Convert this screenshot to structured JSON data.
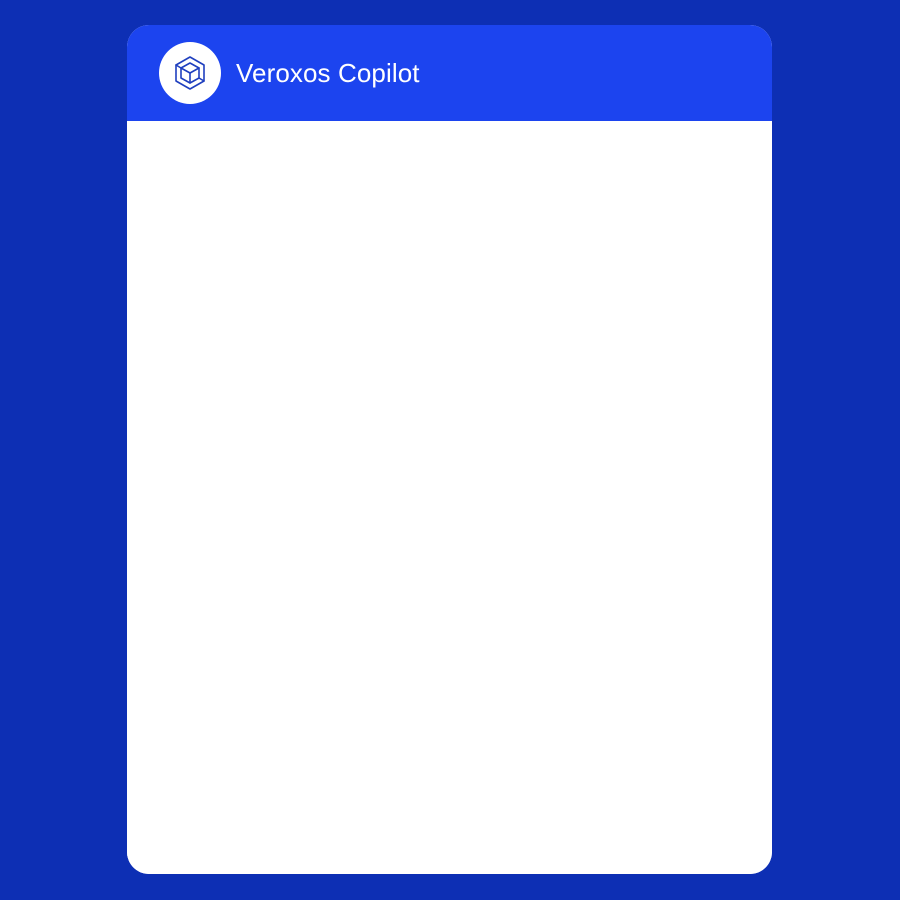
{
  "header": {
    "title": "Veroxos Copilot",
    "logo_icon": "hexagon-cube-icon"
  },
  "colors": {
    "background": "#0d2fb4",
    "header": "#1c44ef",
    "panel": "#ffffff",
    "icon_stroke": "#1f3fbf"
  }
}
